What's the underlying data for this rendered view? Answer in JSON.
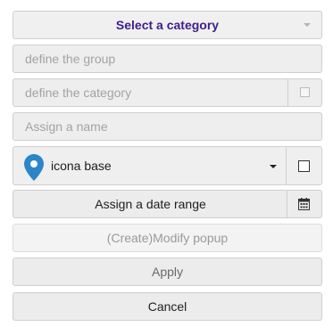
{
  "category_select": {
    "label": "Select a category"
  },
  "group_field": {
    "placeholder": "define the group"
  },
  "category_field": {
    "placeholder": "define the category",
    "checked": false
  },
  "name_field": {
    "placeholder": "Assign a name"
  },
  "icon_select": {
    "selected": "icona base",
    "icon": "map-pin-icon",
    "icon_color": "#2b86c9",
    "checked": false
  },
  "date_range": {
    "label": "Assign a date range",
    "icon": "calendar-icon"
  },
  "buttons": {
    "popup_label": "(Create)Modify popup",
    "apply_label": "Apply",
    "cancel_label": "Cancel"
  },
  "colors": {
    "select_label": "#3d1f8a"
  }
}
